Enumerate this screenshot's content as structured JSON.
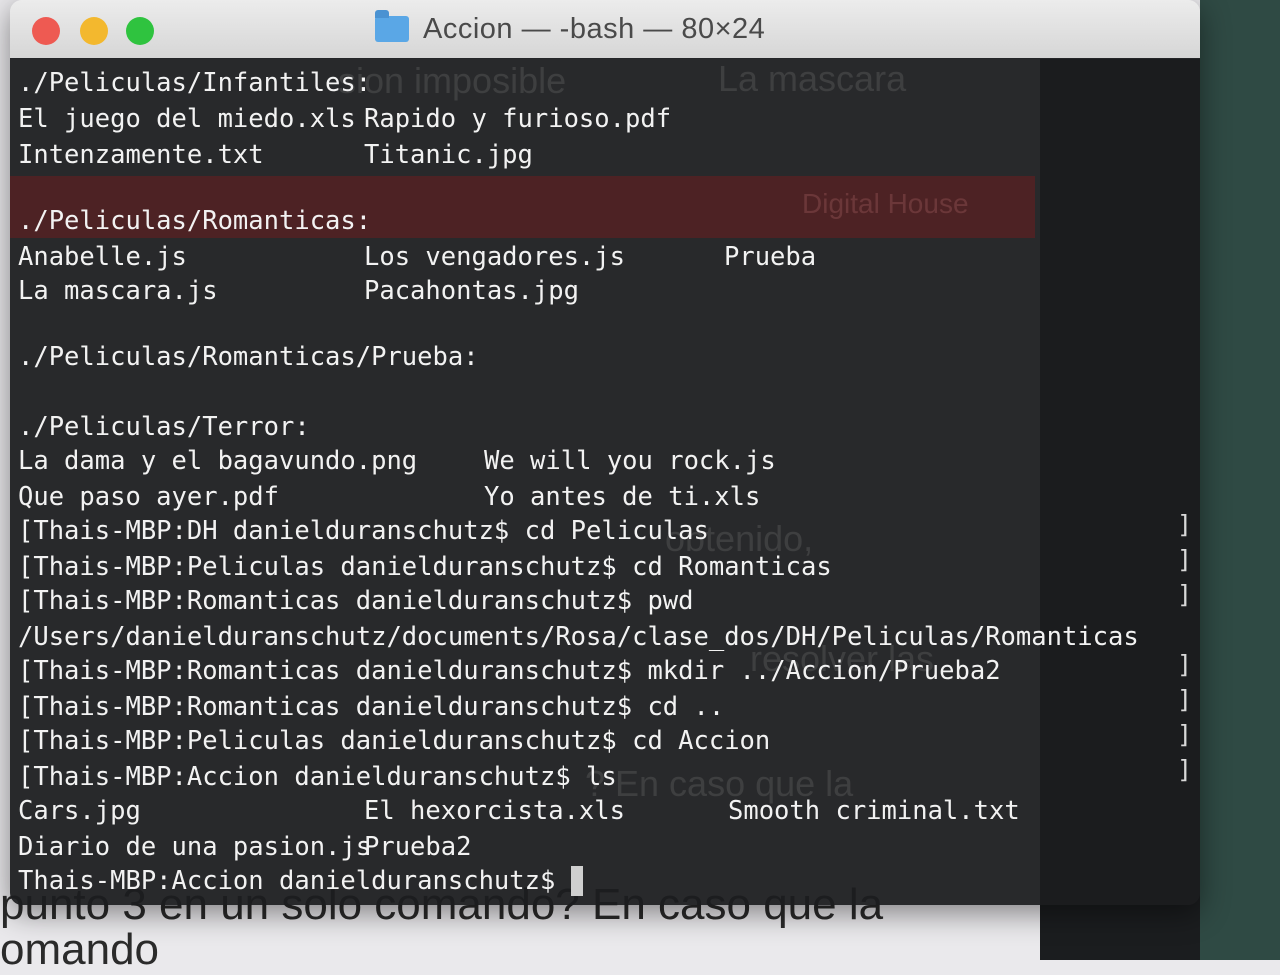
{
  "window": {
    "title": "Accion — -bash — 80×24"
  },
  "background": {
    "snippets": [
      "sion imposible",
      "La mascara",
      "Digital House",
      "obtenido,",
      "resolver las",
      "? En caso que la",
      "punto 3 en un solo comando? En caso que la",
      "omando"
    ]
  },
  "terminal": {
    "lines": [
      {
        "text": "./Peliculas/Infantiles:"
      },
      {
        "cols": [
          "El juego del miedo.xls",
          "Rapido y furioso.pdf"
        ]
      },
      {
        "cols": [
          "Intenzamente.txt",
          "Titanic.jpg"
        ]
      },
      {
        "text": ""
      },
      {
        "text": "./Peliculas/Romanticas:"
      },
      {
        "cols": [
          "Anabelle.js",
          "Los vengadores.js",
          "Prueba"
        ]
      },
      {
        "cols": [
          "La mascara.js",
          "Pacahontas.jpg"
        ]
      },
      {
        "text": ""
      },
      {
        "text": "./Peliculas/Romanticas/Prueba:"
      },
      {
        "text": ""
      },
      {
        "text": "./Peliculas/Terror:"
      },
      {
        "cols": [
          "La dama y el bagavundo.png",
          "We will you rock.js"
        ]
      },
      {
        "cols": [
          "Que paso ayer.pdf",
          "Yo antes de ti.xls"
        ]
      },
      {
        "text": "[Thais-MBP:DH danielduranschutz$ cd Peliculas"
      },
      {
        "text": "[Thais-MBP:Peliculas danielduranschutz$ cd Romanticas"
      },
      {
        "text": "[Thais-MBP:Romanticas danielduranschutz$ pwd"
      },
      {
        "text": "/Users/danielduranschutz/documents/Rosa/clase_dos/DH/Peliculas/Romanticas"
      },
      {
        "text": "[Thais-MBP:Romanticas danielduranschutz$ mkdir ../Accion/Prueba2"
      },
      {
        "text": "[Thais-MBP:Romanticas danielduranschutz$ cd .."
      },
      {
        "text": "[Thais-MBP:Peliculas danielduranschutz$ cd Accion"
      },
      {
        "text": "[Thais-MBP:Accion danielduranschutz$ ls"
      },
      {
        "cols": [
          "Cars.jpg",
          "El hexorcista.xls",
          "Smooth criminal.txt"
        ]
      },
      {
        "cols": [
          "Diario de una pasion.js",
          "Prueba2"
        ]
      },
      {
        "text": "Thais-MBP:Accion danielduranschutz$ "
      }
    ]
  }
}
